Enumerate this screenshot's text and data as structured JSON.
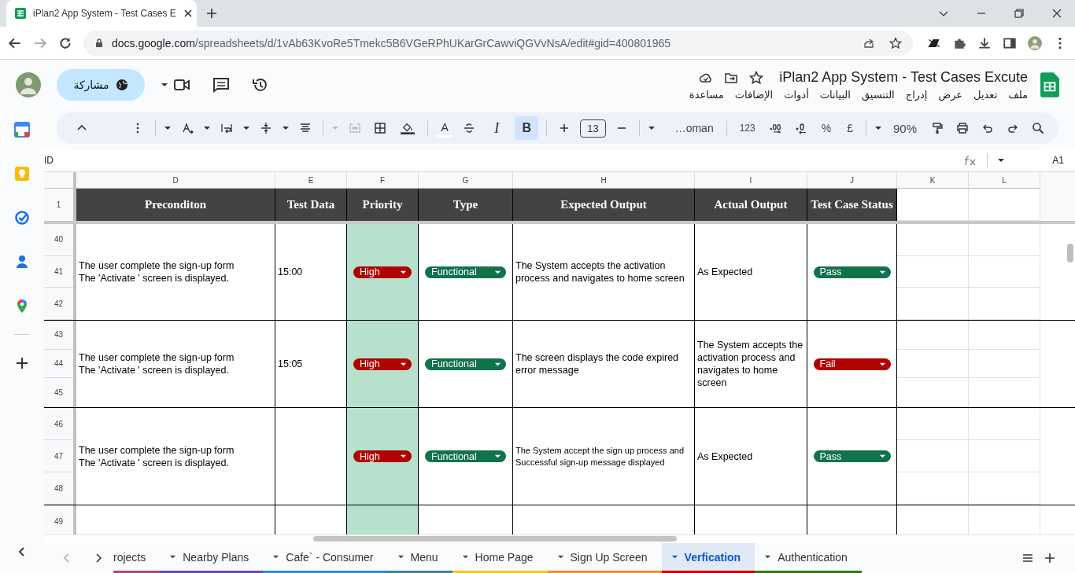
{
  "browser": {
    "tab_title": "iPlan2 App System - Test Cases E",
    "url_host": "docs.google.com",
    "url_path": "/spreadsheets/d/1vAb63KvoRe5Tmekc5B6VGeRPhUKarGrCawviQGVvNsA/edit#gid=400801965"
  },
  "doc": {
    "title": "iPlan2 App System - Test Cases Excute",
    "share": "مشاركة",
    "menu": [
      "ملف",
      "تعديل",
      "عرض",
      "إدراج",
      "التنسيق",
      "البيانات",
      "أدوات",
      "الإضافات",
      "مساعدة"
    ]
  },
  "toolbar": {
    "zoom": "90%",
    "currency": "£",
    "percent": "%",
    "number_format": "123",
    "font": "…oman",
    "font_size": "13",
    "bold": {
      "label": "B",
      "selected": true
    },
    "italic": {
      "label": "I",
      "selected": false
    },
    "text_color": "A"
  },
  "formula_bar": {
    "cell": "A1",
    "content": "ID"
  },
  "columns": [
    "D",
    "E",
    "F",
    "G",
    "H",
    "I",
    "J",
    "K",
    "L"
  ],
  "header_row": {
    "number": "1",
    "cells": [
      "Preconditon",
      "Test Data",
      "Priority",
      "Type",
      "Expected Output",
      "Actual Output",
      "Test Case Status"
    ]
  },
  "records": [
    {
      "rows": [
        "40",
        "41",
        "42"
      ],
      "precondition": "The user complete the  sign-up form\nThe 'Activate ' screen is displayed.",
      "test_data": "15:00",
      "priority": {
        "label": "High",
        "color": "#b10202"
      },
      "type": {
        "label": "Functional",
        "color": "#11734b"
      },
      "expected": "The System accepts the activation process and navigates to home screen",
      "expected_small": false,
      "actual": "As Expected",
      "status": {
        "label": "Pass",
        "color": "#11734b"
      }
    },
    {
      "rows": [
        "43",
        "44",
        "45"
      ],
      "precondition": "The user complete the  sign-up form\nThe 'Activate ' screen is displayed.",
      "test_data": "15:05",
      "priority": {
        "label": "High",
        "color": "#b10202"
      },
      "type": {
        "label": "Functional",
        "color": "#11734b"
      },
      "expected": "The screen displays the code expired error message",
      "expected_small": false,
      "actual": "The System accepts the activation process and navigates to home screen",
      "status": {
        "label": "Fail",
        "color": "#b10202"
      }
    },
    {
      "rows": [
        "46",
        "47",
        "48"
      ],
      "precondition": "The user complete the  sign-up form\nThe 'Activate ' screen is displayed.",
      "priority": {
        "label": "High",
        "color": "#b10202"
      },
      "type": {
        "label": "Functional",
        "color": "#11734b"
      },
      "expected": "The System accept the sign up process and Successful sign-up message displayed",
      "expected_small": true,
      "actual": "As Expected",
      "status": {
        "label": "Pass",
        "color": "#11734b"
      }
    },
    {
      "rows": [
        "49"
      ]
    }
  ],
  "sheet_tabs": [
    {
      "label": "rojects",
      "color": "#a64d79",
      "selected": false,
      "dropdown": false
    },
    {
      "label": "Nearby Plans",
      "color": "#674ea7",
      "selected": false,
      "dropdown": true
    },
    {
      "label": "Cafe` - Consumer",
      "color": "#3d85c6",
      "selected": false,
      "dropdown": true
    },
    {
      "label": "Menu",
      "color": "#45818e",
      "selected": false,
      "dropdown": true
    },
    {
      "label": "Home Page",
      "color": "#f1c232",
      "selected": false,
      "dropdown": true
    },
    {
      "label": "Sign Up Screen",
      "color": "#e69138",
      "selected": false,
      "dropdown": true
    },
    {
      "label": "Verfication",
      "color": "#cc0000",
      "selected": true,
      "dropdown": true
    },
    {
      "label": "Authentication",
      "color": "#38761d",
      "selected": false,
      "dropdown": true
    }
  ]
}
